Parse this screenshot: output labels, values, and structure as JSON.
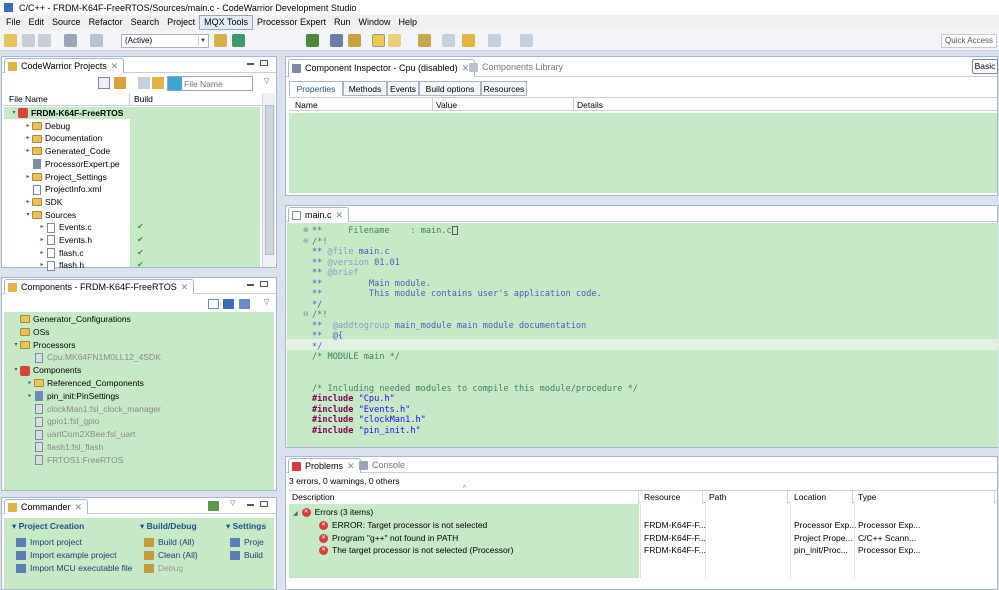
{
  "window": {
    "title": "C/C++ - FRDM-K64F-FreeRTOS/Sources/main.c - CodeWarrior Development Studio"
  },
  "menu": [
    "File",
    "Edit",
    "Source",
    "Refactor",
    "Search",
    "Project",
    "MQX Tools",
    "Processor Expert",
    "Run",
    "Window",
    "Help"
  ],
  "toolbar": {
    "config": "(Active)",
    "quick_access": "Quick Access"
  },
  "projects_panel": {
    "tab": "CodeWarrior Projects",
    "filter_placeholder": "File Name",
    "col_file": "File Name",
    "col_build": "Build",
    "rows": [
      {
        "label": "FRDM-K64F-FreeRTOS",
        "level": 0,
        "type": "project",
        "twisty": "▾",
        "bold": true
      },
      {
        "label": "Debug",
        "level": 1,
        "type": "folder",
        "twisty": "▸"
      },
      {
        "label": "Documentation",
        "level": 1,
        "type": "folder",
        "twisty": "▸"
      },
      {
        "label": "Generated_Code",
        "level": 1,
        "type": "folder",
        "twisty": "▸"
      },
      {
        "label": "ProcessorExpert.pe",
        "level": 1,
        "type": "pe",
        "twisty": ""
      },
      {
        "label": "Project_Settings",
        "level": 1,
        "type": "folder",
        "twisty": "▸"
      },
      {
        "label": "ProjectInfo.xml",
        "level": 1,
        "type": "file",
        "twisty": ""
      },
      {
        "label": "SDK",
        "level": 1,
        "type": "folder",
        "twisty": "▸"
      },
      {
        "label": "Sources",
        "level": 1,
        "type": "folder",
        "twisty": "▾"
      },
      {
        "label": "Events.c",
        "level": 2,
        "type": "file",
        "twisty": "▸",
        "check": "✔"
      },
      {
        "label": "Events.h",
        "level": 2,
        "type": "file",
        "twisty": "▸",
        "check": "✔"
      },
      {
        "label": "flash.c",
        "level": 2,
        "type": "file",
        "twisty": "▸",
        "check": "✔"
      },
      {
        "label": "flash.h",
        "level": 2,
        "type": "file",
        "twisty": "▸",
        "check": "✔"
      }
    ]
  },
  "components_panel": {
    "tab": "Components - FRDM-K64F-FreeRTOS",
    "rows": [
      {
        "label": "Generator_Configurations",
        "level": 0,
        "type": "folder",
        "twisty": ""
      },
      {
        "label": "OSs",
        "level": 0,
        "type": "folder",
        "twisty": ""
      },
      {
        "label": "Processors",
        "level": 0,
        "type": "folder",
        "twisty": "▾"
      },
      {
        "label": "Cpu:MK64FN1M0LL12_4SDK",
        "level": 1,
        "type": "comp",
        "twisty": "",
        "gray": true
      },
      {
        "label": "Components",
        "level": 0,
        "type": "red",
        "twisty": "▾"
      },
      {
        "label": "Referenced_Components",
        "level": 1,
        "type": "folder",
        "twisty": "▸"
      },
      {
        "label": "pin_init:PinSettings",
        "level": 1,
        "type": "pin",
        "twisty": "▸"
      },
      {
        "label": "clockMan1:fsl_clock_manager",
        "level": 1,
        "type": "comp",
        "twisty": "",
        "gray": true
      },
      {
        "label": "gpio1:fsl_gpio",
        "level": 1,
        "type": "comp",
        "twisty": "",
        "gray": true
      },
      {
        "label": "uartCom2XBee:fsl_uart",
        "level": 1,
        "type": "comp",
        "twisty": "",
        "gray": true
      },
      {
        "label": "flash1:fsl_flash",
        "level": 1,
        "type": "comp",
        "twisty": "",
        "gray": true
      },
      {
        "label": "FRTOS1:FreeRTOS",
        "level": 1,
        "type": "comp",
        "twisty": "",
        "gray": true
      }
    ]
  },
  "commander_panel": {
    "tab": "Commander",
    "sections": [
      {
        "title": "Project Creation",
        "items": [
          "Import project",
          "Import example project",
          "Import MCU executable file"
        ]
      },
      {
        "title": "Build/Debug",
        "items": [
          "Build  (All)",
          "Clean  (All)",
          "Debug"
        ]
      },
      {
        "title": "Settings",
        "items": [
          "Proje",
          "Build"
        ]
      }
    ]
  },
  "inspector_panel": {
    "tab": "Component Inspector - Cpu (disabled)",
    "tab2": "Components Library",
    "mode": "Basic",
    "subtabs": [
      "Properties",
      "Methods",
      "Events",
      "Build options",
      "Resources"
    ],
    "columns": [
      "Name",
      "Value",
      "Details"
    ]
  },
  "editor": {
    "tab": "main.c",
    "lines": [
      {
        "parts": [
          [
            "cmt",
            "**     Filename    : main.c"
          ],
          [
            "box",
            ""
          ]
        ],
        "fold": "⊕"
      },
      {
        "parts": [
          [
            "cmt",
            "/*!"
          ]
        ],
        "fold": "⊖"
      },
      {
        "parts": [
          [
            "doc",
            "** "
          ],
          [
            "tag",
            "@file"
          ],
          [
            "doc",
            " main.c"
          ]
        ]
      },
      {
        "parts": [
          [
            "doc",
            "** "
          ],
          [
            "tag",
            "@version"
          ],
          [
            "doc",
            " 01.01"
          ]
        ]
      },
      {
        "parts": [
          [
            "doc",
            "** "
          ],
          [
            "tag",
            "@brief"
          ]
        ]
      },
      {
        "parts": [
          [
            "doc",
            "**         Main module."
          ]
        ]
      },
      {
        "parts": [
          [
            "doc",
            "**         This module contains user's application code."
          ]
        ]
      },
      {
        "parts": [
          [
            "doc",
            "*/"
          ]
        ]
      },
      {
        "parts": [
          [
            "cmt",
            "/*!"
          ]
        ],
        "fold": "⊖"
      },
      {
        "parts": [
          [
            "doc",
            "**  "
          ],
          [
            "tag",
            "@addtogroup"
          ],
          [
            "doc",
            " main_module main module documentation"
          ]
        ]
      },
      {
        "parts": [
          [
            "doc",
            "**  @{"
          ]
        ],
        "current": true
      },
      {
        "parts": [
          [
            "doc",
            "*/"
          ]
        ]
      },
      {
        "parts": [
          [
            "cmt",
            "/* MODULE main */"
          ]
        ]
      },
      {
        "parts": [
          [
            "cmt",
            ""
          ]
        ]
      },
      {
        "parts": [
          [
            "cmt",
            ""
          ]
        ]
      },
      {
        "parts": [
          [
            "cmt",
            "/* Including needed modules to compile this module/procedure */"
          ]
        ]
      },
      {
        "parts": [
          [
            "kw",
            "#include"
          ],
          [
            "str",
            " \"Cpu.h\""
          ]
        ]
      },
      {
        "parts": [
          [
            "kw",
            "#include"
          ],
          [
            "str",
            " \"Events.h\""
          ]
        ]
      },
      {
        "parts": [
          [
            "kw",
            "#include"
          ],
          [
            "str",
            " \"clockMan1.h\""
          ]
        ]
      },
      {
        "parts": [
          [
            "kw",
            "#include"
          ],
          [
            "str",
            " \"pin_init.h\""
          ]
        ]
      }
    ]
  },
  "problems_panel": {
    "tab": "Problems",
    "tab2": "Console",
    "summary": "3 errors, 0 warnings, 0 others",
    "columns": [
      "Description",
      "Resource",
      "Path",
      "Location",
      "Type"
    ],
    "group": "Errors (3 items)",
    "rows": [
      {
        "description": "ERROR: Target processor is not selected",
        "resource": "FRDM-K64F-F...",
        "path": "",
        "location": "Processor Exp...",
        "type": "Processor Exp..."
      },
      {
        "description": "Program \"g++\" not found in PATH",
        "resource": "FRDM-K64F-F...",
        "path": "",
        "location": "Project Prope...",
        "type": "C/C++ Scann..."
      },
      {
        "description": "The target processor is not selected (Processor)",
        "resource": "FRDM-K64F-F...",
        "path": "",
        "location": "pin_init/Proc...",
        "type": "Processor Exp..."
      }
    ]
  },
  "colors": {
    "accent": "#3a6fb7",
    "selection_green": "#c6eac6",
    "error": "#d93a3a"
  }
}
